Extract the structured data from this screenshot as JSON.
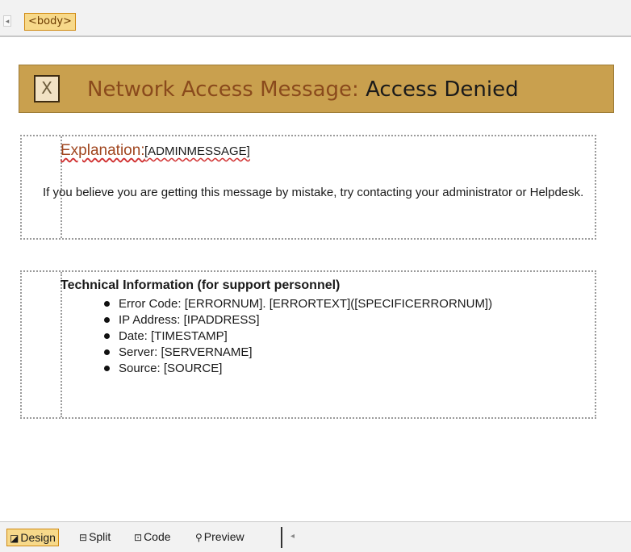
{
  "editor": {
    "tag_selector": "<body>"
  },
  "banner": {
    "close_glyph": "X",
    "title_lead": "Network Access Message:",
    "title_status": "Access Denied"
  },
  "explanation": {
    "label": "Explanation:",
    "value": "[ADMINMESSAGE]",
    "paragraph": "If you believe you are getting this message by mistake, try contacting your administrator or Helpdesk."
  },
  "technical": {
    "title": "Technical Information (for support personnel)",
    "items": [
      "Error Code: [ERRORNUM]. [ERRORTEXT]([SPECIFICERRORNUM])",
      "IP Address: [IPADDRESS]",
      "Date: [TIMESTAMP]",
      "Server: [SERVERNAME]",
      "Source: [SOURCE]"
    ]
  },
  "view_tabs": {
    "design": "Design",
    "split": "Split",
    "code": "Code",
    "preview": "Preview"
  },
  "colors": {
    "banner_bg": "#c9a04e",
    "title_lead": "#8a4a1c",
    "active_tab": "#f7d98a"
  }
}
